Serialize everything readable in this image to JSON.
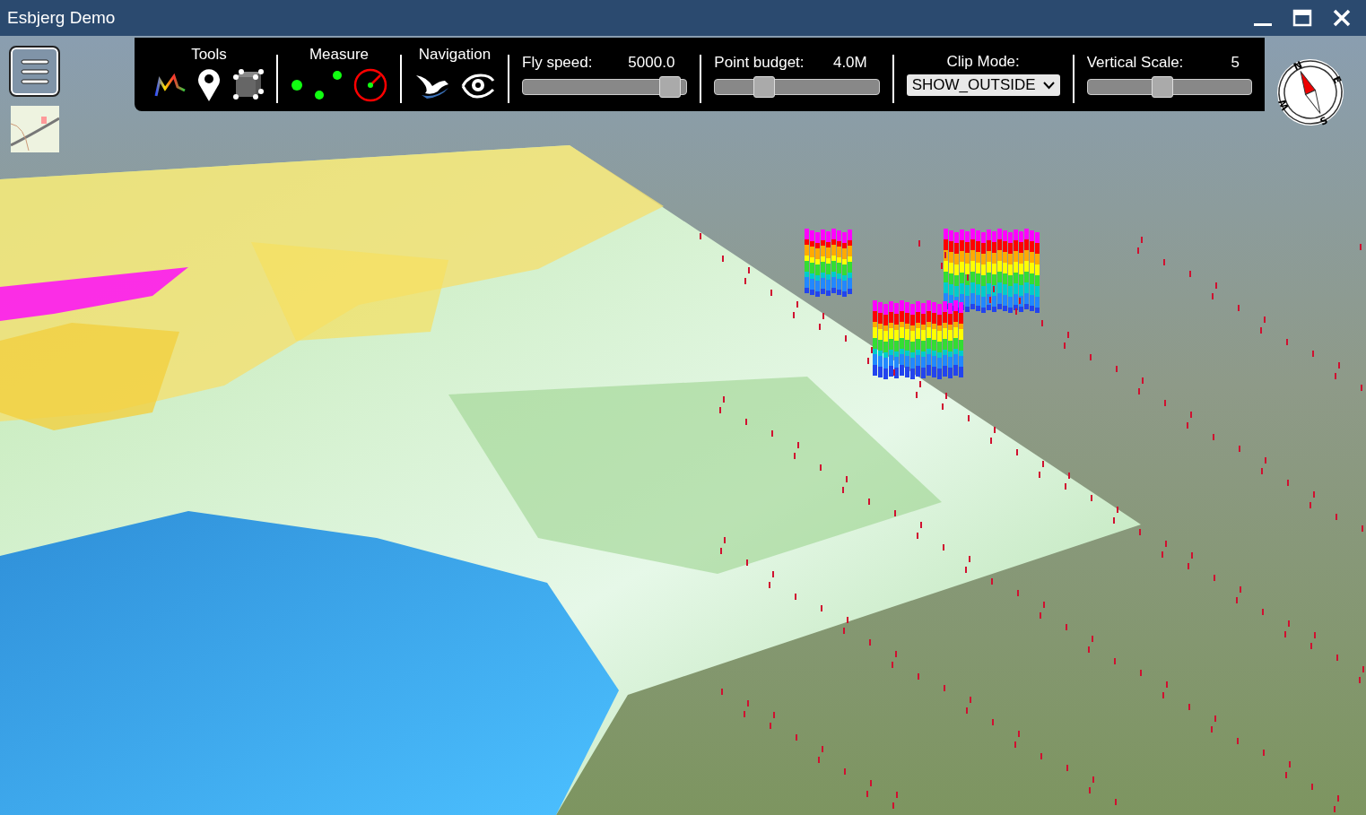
{
  "window": {
    "title": "Esbjerg Demo"
  },
  "toolbar": {
    "tools": {
      "label": "Tools"
    },
    "measure": {
      "label": "Measure"
    },
    "navigation": {
      "label": "Navigation"
    },
    "sliders": [
      {
        "label": "Fly speed:",
        "reading": "5000.0",
        "level": 0.96
      },
      {
        "label": "Point budget:",
        "reading": "4.0M",
        "level": 0.27
      }
    ],
    "clip_mode": {
      "label": "Clip Mode:",
      "value": "SHOW_OUTSIDE"
    },
    "vertical_scale": {
      "label": "Vertical Scale:",
      "reading": "5",
      "level": 0.45
    }
  },
  "compass": {
    "north": "N",
    "east": "E",
    "south": "S",
    "west": "W"
  }
}
